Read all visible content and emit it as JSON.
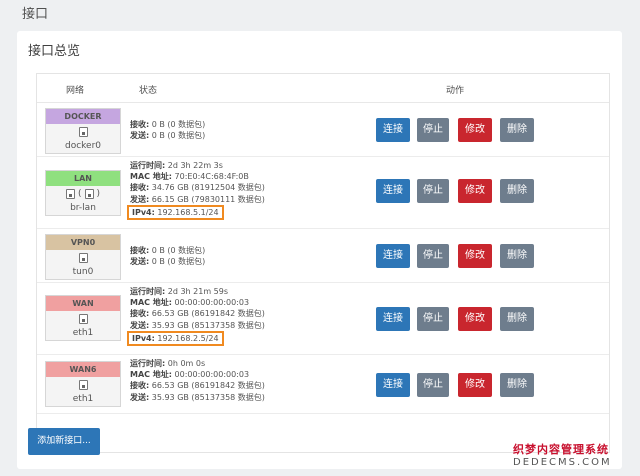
{
  "page": {
    "title": "接口"
  },
  "panel": {
    "title": "接口总览"
  },
  "table": {
    "headers": {
      "network": "网络",
      "status": "状态",
      "action": "动作"
    }
  },
  "actions": {
    "connect": "连接",
    "stop": "停止",
    "edit": "修改",
    "delete": "删除"
  },
  "add_button": "添加新接口...",
  "colors": {
    "docker": "#c5a6e0",
    "lan": "#8fe07f",
    "vpn": "#d8c3a2",
    "wan": "#f0a0a0",
    "wan6": "#f0a0a0",
    "highlight": "#f08a20",
    "primary": "#2d76b7",
    "danger": "#c9262e",
    "secondary": "#6e7d8d"
  },
  "interfaces": [
    {
      "name": "DOCKER",
      "device": "docker0",
      "icons": [
        "port-icon"
      ],
      "lines": [
        {
          "label": "接收:",
          "value": " 0 B (0 数据包)"
        },
        {
          "label": "发送:",
          "value": " 0 B (0 数据包)"
        }
      ]
    },
    {
      "name": "LAN",
      "device": "br-lan",
      "icons": [
        "port-icon",
        "port-icon"
      ],
      "icon_text": "(",
      "icon_text_close": ")",
      "lines": [
        {
          "label": "运行时间:",
          "value": " 2d 3h 22m 3s"
        },
        {
          "label": "MAC 地址:",
          "value": " 70:E0:4C:68:4F:0B"
        },
        {
          "label": "接收:",
          "value": " 34.76 GB (81912504 数据包)"
        },
        {
          "label": "发送:",
          "value": " 66.15 GB (79830111 数据包)"
        }
      ],
      "ipv4_label": "IPv4:",
      "ipv4": " 192.168.5.1/24"
    },
    {
      "name": "VPN0",
      "device": "tun0",
      "icons": [
        "port-icon"
      ],
      "lines": [
        {
          "label": "接收:",
          "value": " 0 B (0 数据包)"
        },
        {
          "label": "发送:",
          "value": " 0 B (0 数据包)"
        }
      ]
    },
    {
      "name": "WAN",
      "device": "eth1",
      "icons": [
        "port-icon"
      ],
      "lines": [
        {
          "label": "运行时间:",
          "value": " 2d 3h 21m 59s"
        },
        {
          "label": "MAC 地址:",
          "value": " 00:00:00:00:00:03"
        },
        {
          "label": "接收:",
          "value": " 66.53 GB (86191842 数据包)"
        },
        {
          "label": "发送:",
          "value": " 35.93 GB (85137358 数据包)"
        }
      ],
      "ipv4_label": "IPv4:",
      "ipv4": " 192.168.2.5/24"
    },
    {
      "name": "WAN6",
      "device": "eth1",
      "icons": [
        "port-icon"
      ],
      "lines": [
        {
          "label": "运行时间:",
          "value": " 0h 0m 0s"
        },
        {
          "label": "MAC 地址:",
          "value": " 00:00:00:00:00:03"
        },
        {
          "label": "接收:",
          "value": " 66.53 GB (86191842 数据包)"
        },
        {
          "label": "发送:",
          "value": " 35.93 GB (85137358 数据包)"
        }
      ]
    }
  ],
  "watermark": {
    "line1": "织梦内容管理系统",
    "line2": "DEDECMS.COM"
  }
}
